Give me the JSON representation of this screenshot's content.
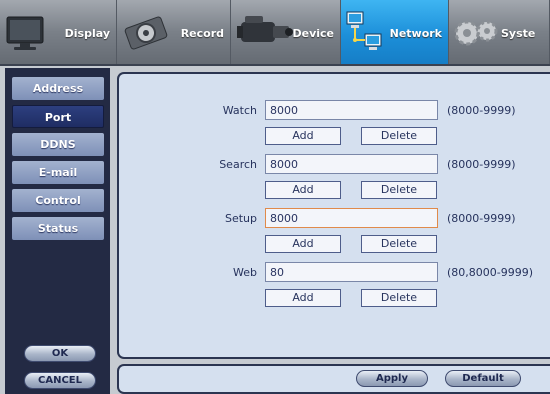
{
  "tabs": [
    {
      "label": "Display",
      "icon": "monitor-icon"
    },
    {
      "label": "Record",
      "icon": "film-reel-icon"
    },
    {
      "label": "Device",
      "icon": "camcorder-icon"
    },
    {
      "label": "Network",
      "icon": "network-computers-icon",
      "active": true
    },
    {
      "label": "Syste",
      "icon": "gears-icon"
    }
  ],
  "sidebar": {
    "items": [
      {
        "label": "Address"
      },
      {
        "label": "Port",
        "active": true
      },
      {
        "label": "DDNS"
      },
      {
        "label": "E-mail"
      },
      {
        "label": "Control"
      },
      {
        "label": "Status"
      }
    ],
    "ok_label": "OK",
    "cancel_label": "CANCEL"
  },
  "ports": {
    "watch": {
      "label": "Watch",
      "value": "8000",
      "range": "(8000-9999)"
    },
    "search": {
      "label": "Search",
      "value": "8000",
      "range": "(8000-9999)"
    },
    "setup": {
      "label": "Setup",
      "value": "8000",
      "range": "(8000-9999)",
      "focused": true
    },
    "web": {
      "label": "Web",
      "value": "80",
      "range": "(80,8000-9999)"
    }
  },
  "buttons": {
    "add_label": "Add",
    "delete_label": "Delete"
  },
  "footer": {
    "apply_label": "Apply",
    "default_label": "Default"
  },
  "colors": {
    "active_tab": "#1c8fd9",
    "nav_background": "#232a44",
    "panel_background": "#d5e0ef",
    "focused_border": "#e08a4a"
  }
}
